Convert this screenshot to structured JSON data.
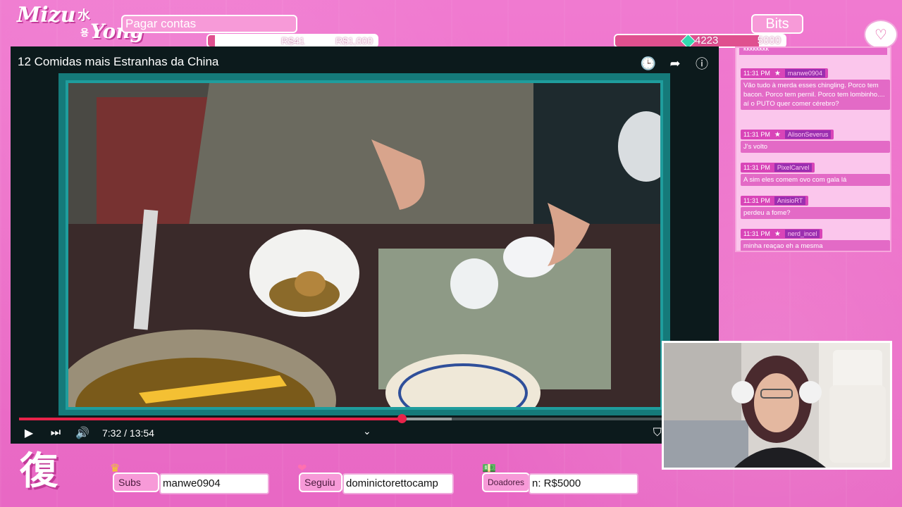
{
  "logo": {
    "name_1": "Mizu",
    "name_2": "Yong",
    "kanji": "水",
    "hangul": "용"
  },
  "goal": {
    "label": "Pagar contas",
    "current": "R$41",
    "target": "R$1,000"
  },
  "bits": {
    "label": "Bits",
    "current": "4223",
    "target": "5000"
  },
  "video": {
    "title": "12 Comidas mais Estranhas da China",
    "time": "7:32 / 13:54",
    "progress_played_pct": 54,
    "progress_loaded_pct": 67
  },
  "chat": {
    "previous_fragment": "kkkkkkkk",
    "messages": [
      {
        "time": "11:31 PM",
        "user": "manwe0904",
        "text": "Vão tudo à merda esses chingling. Porco tem bacon. Porco tem pernil. Porco tem lombinho.... aí o PUTO quer comer cérebro?"
      },
      {
        "time": "11:31 PM",
        "user": "AlisonSeverus",
        "text": "J's volto"
      },
      {
        "time": "11:31 PM",
        "user": "PixelCarvel",
        "text": "A sim eles comem ovo com gala lá"
      },
      {
        "time": "11:31 PM",
        "user": "AnisioRT",
        "text": "perdeu a fome?"
      },
      {
        "time": "11:31 PM",
        "user": "nerd_incel",
        "text": "minha reaçao eh a mesma"
      }
    ]
  },
  "bottom": {
    "kanji": "復",
    "subs": {
      "label": "Subs",
      "value": "manwe0904"
    },
    "follow": {
      "label": "Seguiu",
      "value": "dominictorettocamp"
    },
    "donors": {
      "label": "Doadores",
      "value": "n: R$5000"
    }
  },
  "colors": {
    "accent": "#e0508f",
    "teal": "#1f9d9d",
    "progress": "#e8234a"
  }
}
